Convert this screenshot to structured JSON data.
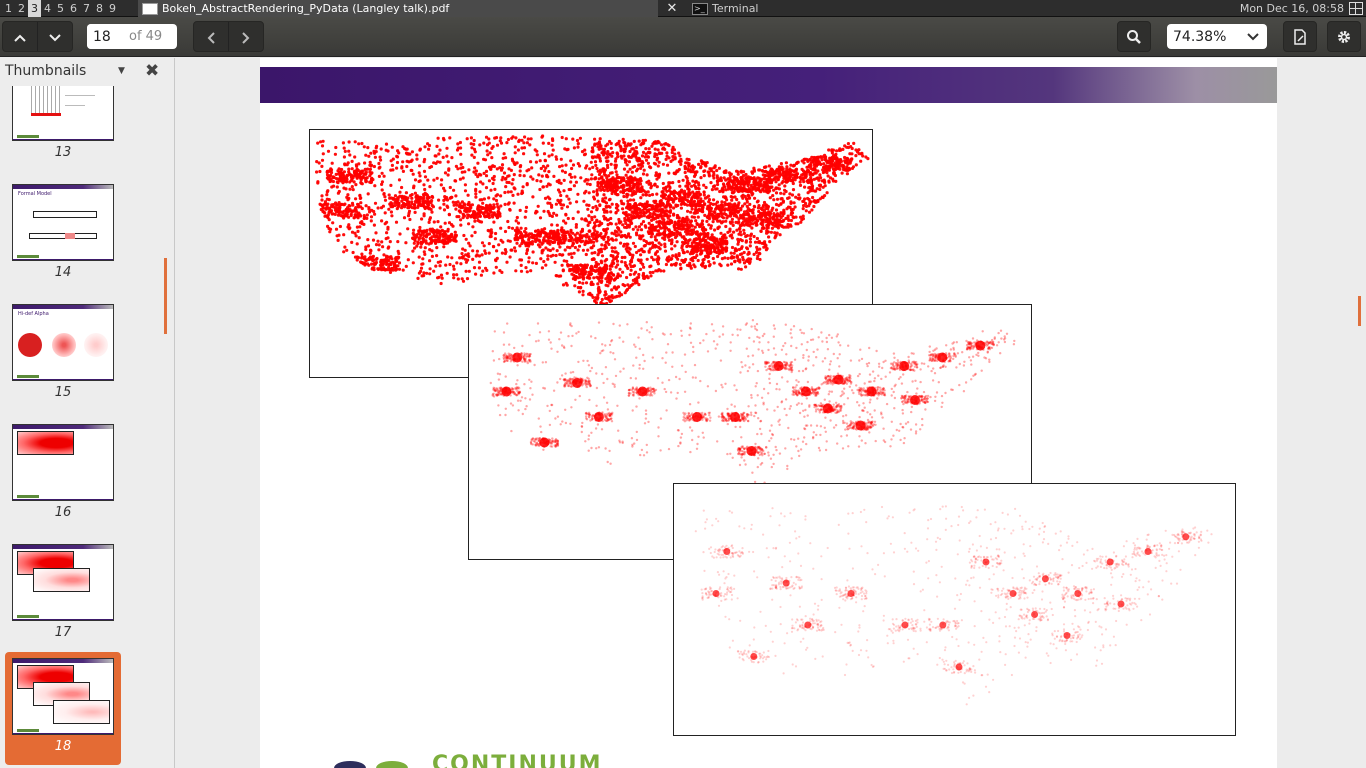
{
  "topbar": {
    "workspaces": [
      "1",
      "2",
      "3",
      "4",
      "5",
      "6",
      "7",
      "8",
      "9"
    ],
    "active_workspace": "3",
    "tasks": [
      {
        "title": "Bokeh_AbstractRendering_PyData (Langley talk).pdf",
        "icon": "document-icon",
        "active": true
      },
      {
        "title": "Terminal",
        "icon": "terminal-icon",
        "active": false
      }
    ],
    "clock": "Mon Dec 16, 08:58"
  },
  "toolbar": {
    "current_page": "18",
    "page_count_label": "of 49",
    "zoom": "74.38%"
  },
  "sidebar": {
    "title": "Thumbnails",
    "thumbnails": [
      {
        "page": "13",
        "title": ""
      },
      {
        "page": "14",
        "title": "Formal Model"
      },
      {
        "page": "15",
        "title": "Hi-def Alpha"
      },
      {
        "page": "16",
        "title": ""
      },
      {
        "page": "17",
        "title": ""
      },
      {
        "page": "18",
        "title": "",
        "selected": true
      }
    ]
  },
  "document": {
    "footer_logo_text": "CONTINUUM",
    "colors": {
      "banner": "#3b166a",
      "map_red": "#ff0000",
      "selection": "#e46b34",
      "logo_green": "#7cae3c"
    }
  }
}
